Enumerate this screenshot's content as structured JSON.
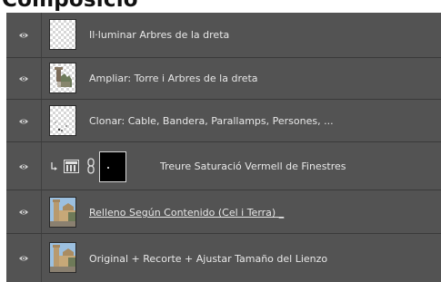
{
  "panel_title": "Composició",
  "layers": [
    {
      "name": "Il·luminar Arbres de la dreta",
      "kind": "transparent"
    },
    {
      "name": "Ampliar: Torre i Arbres de la dreta",
      "kind": "transparent-torre"
    },
    {
      "name": "Clonar: Cable, Bandera, Parallamps, Persones, ...",
      "kind": "transparent-dots"
    },
    {
      "name": "Treure Saturació Vermell de Finestres",
      "kind": "adjustment"
    },
    {
      "name": "Relleno Según Contenido (Cel i Terra)",
      "kind": "photo",
      "name_suffix": "_"
    },
    {
      "name": "Original + Recorte + Ajustar Tamaño del Lienzo",
      "kind": "photo"
    }
  ],
  "colors": {
    "panel": "#535353",
    "separator": "#3a3a3a",
    "text": "#e8e8e8"
  },
  "icons": {
    "visibility": "eye-icon",
    "clip": "clip-arrow-icon",
    "adjustment": "levels-icon",
    "link": "chain-link-icon"
  }
}
